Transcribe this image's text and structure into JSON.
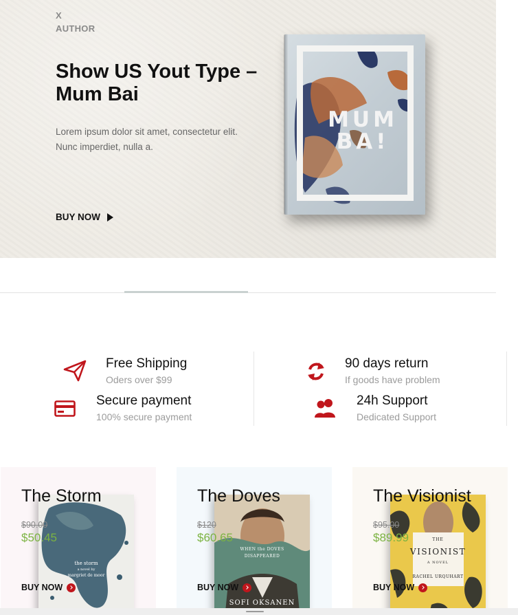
{
  "hero": {
    "x_label": "X",
    "author_label": "AUTHOR",
    "title": "Show US Yout Type – Mum Bai",
    "description": "Lorem ipsum dolor sit amet, consectetur elit. Nunc imperdiet, nulla a.",
    "buy_label": "BUY NOW",
    "book_cover_text": "MUM BA!"
  },
  "slider": {
    "active_index": 1,
    "total": 4
  },
  "features": [
    {
      "icon": "paper-plane-icon",
      "title": "Free Shipping",
      "subtitle": "Oders over $99"
    },
    {
      "icon": "refresh-icon",
      "title": "90 days return",
      "subtitle": "If goods have problem"
    },
    {
      "icon": "credit-card-icon",
      "title": "Secure payment",
      "subtitle": "100% secure payment"
    },
    {
      "icon": "users-icon",
      "title": "24h Support",
      "subtitle": "Dedicated Support"
    }
  ],
  "products": [
    {
      "title": "The Storm",
      "old_price": "$90.00",
      "price": "$50.45",
      "buy_label": "BUY NOW",
      "bg": "#fcf6f8",
      "cover_line1": "the storm",
      "cover_line2": "a novel by",
      "cover_line3": "margriet de moor"
    },
    {
      "title": "The Doves",
      "old_price": "$120",
      "price": "$60.65",
      "buy_label": "BUY NOW",
      "bg": "#f4f9fc",
      "cover_line1": "WHEN the DOVES",
      "cover_line2": "DISAPPEARED",
      "cover_line3": "SOFI OKSANEN"
    },
    {
      "title": "The Visionist",
      "old_price": "$95.00",
      "price": "$89.99",
      "buy_label": "BUY NOW",
      "bg": "#fbf8f3",
      "cover_line1": "THE",
      "cover_line2": "VISIONIST",
      "cover_line3": "RACHEL URQUHART",
      "cover_sub": "A NOVEL"
    }
  ],
  "colors": {
    "accent": "#c0161c",
    "price_green": "#7cb342",
    "hero_bg": "#efece5"
  }
}
